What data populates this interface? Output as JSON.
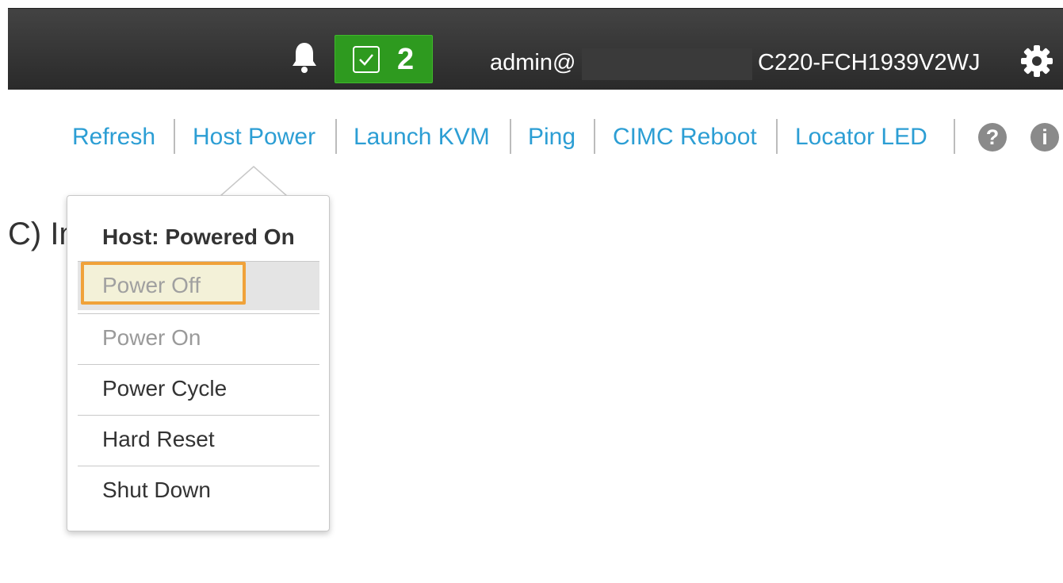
{
  "header": {
    "notification_count": "2",
    "user": "admin@",
    "hostname": "C220-FCH1939V2WJ"
  },
  "toolbar": {
    "items": [
      {
        "label": "Refresh"
      },
      {
        "label": "Host Power"
      },
      {
        "label": "Launch KVM"
      },
      {
        "label": "Ping"
      },
      {
        "label": "CIMC Reboot"
      },
      {
        "label": "Locator LED"
      }
    ],
    "help_glyph": "?",
    "info_glyph": "i"
  },
  "page": {
    "partial_title": "C) In"
  },
  "power_menu": {
    "header": "Host: Powered On",
    "items": [
      {
        "label": "Power Off"
      },
      {
        "label": "Power On"
      },
      {
        "label": "Power Cycle"
      },
      {
        "label": "Hard Reset"
      },
      {
        "label": "Shut Down"
      }
    ]
  },
  "colors": {
    "link": "#2c9ed4",
    "badge_green": "#2e9a1f",
    "highlight_orange": "#f0a23a"
  },
  "icons": [
    "bell-icon",
    "checkbox-icon",
    "gear-icon",
    "help-icon",
    "info-icon"
  ]
}
